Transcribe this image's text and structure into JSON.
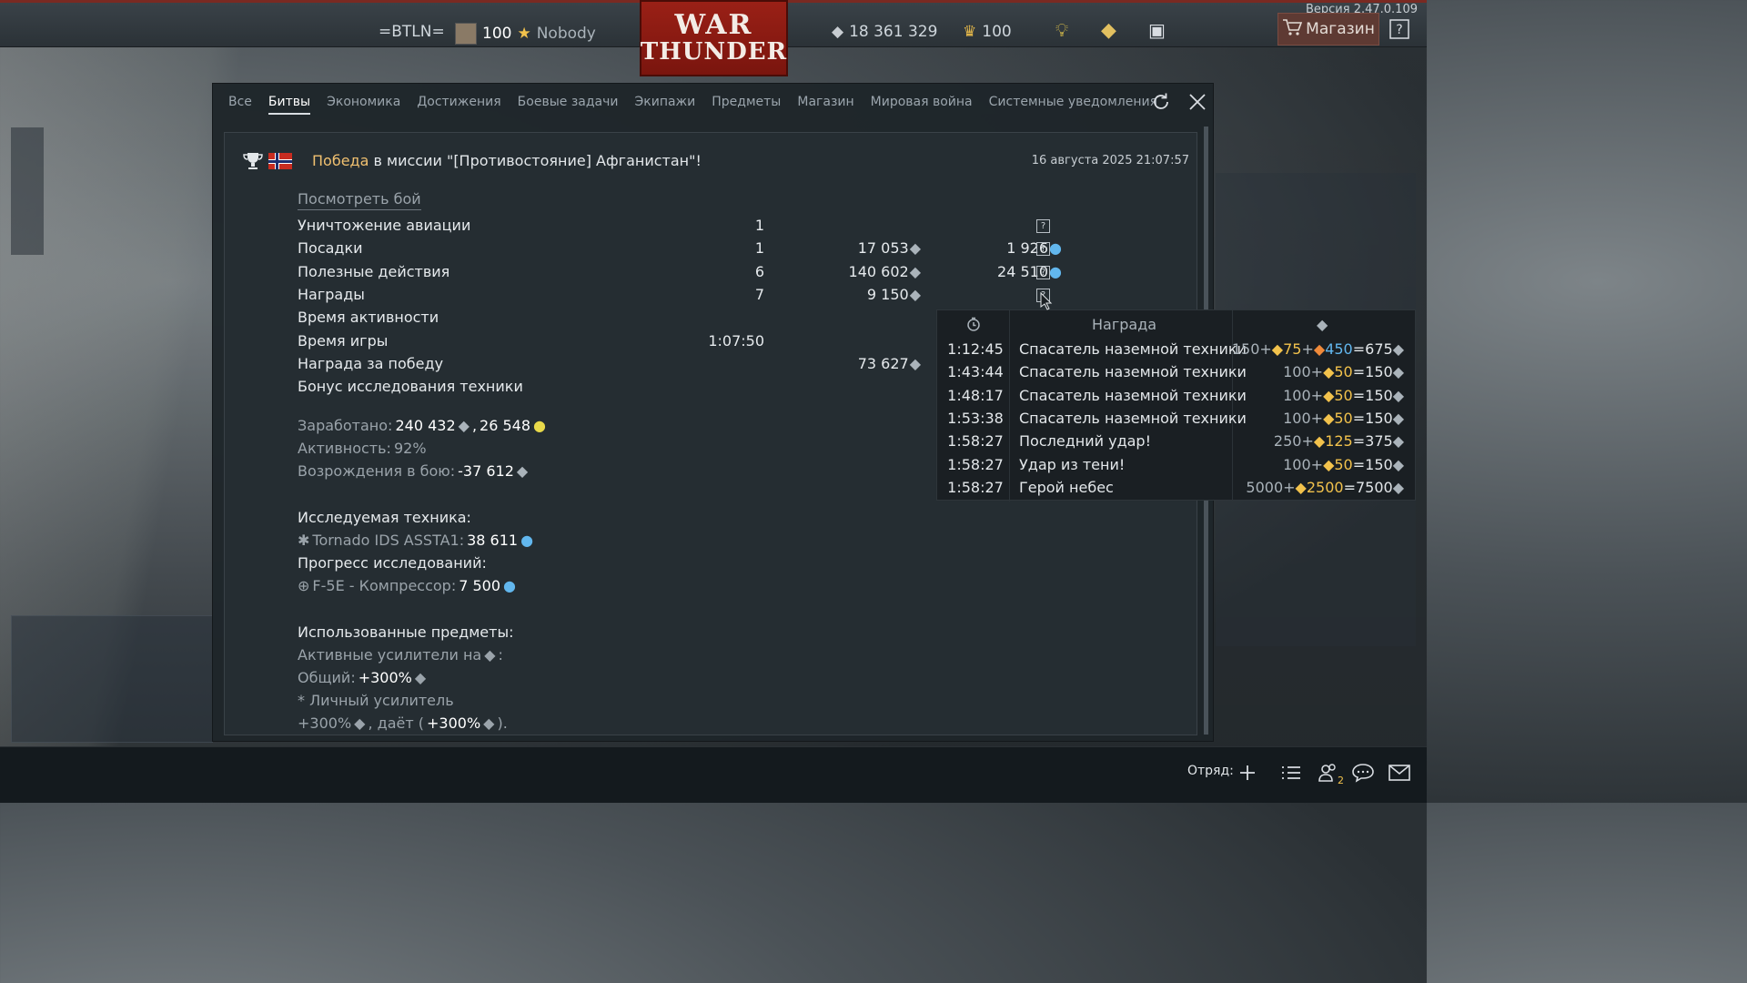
{
  "topbar": {
    "version": "Версия 2.47.0.109",
    "squad_tag": "=BTLN=",
    "level": "100",
    "nickname": "Nobody",
    "silver_lions": "18 361 329",
    "golden_eagles": "100",
    "logo_line1": "WAR",
    "logo_line2": "THUNDER",
    "shop_label": "Магазин",
    "help_label": "?"
  },
  "tabs": [
    {
      "label": "Все"
    },
    {
      "label": "Битвы"
    },
    {
      "label": "Экономика"
    },
    {
      "label": "Достижения"
    },
    {
      "label": "Боевые задачи"
    },
    {
      "label": "Экипажи"
    },
    {
      "label": "Предметы"
    },
    {
      "label": "Магазин"
    },
    {
      "label": "Мировая война"
    },
    {
      "label": "Системные уведомления"
    }
  ],
  "message": {
    "victory_word": "Победа",
    "title_rest": " в миссии \"[Противостояние] Афганистан\"!",
    "date": "16 августа 2025 21:07:57",
    "watch_battle": "Посмотреть бой",
    "rows": [
      {
        "label": "Уничтожение авиации",
        "count": "1",
        "silver": "",
        "rp": "",
        "help": true
      },
      {
        "label": "Посадки",
        "count": "1",
        "silver": "17 053",
        "rp": "1 926",
        "help": true
      },
      {
        "label": "Полезные действия",
        "count": "6",
        "silver": "140 602",
        "rp": "24 510",
        "help": true
      },
      {
        "label": "Награды",
        "count": "7",
        "silver": "9 150",
        "rp": "",
        "help": true
      },
      {
        "label": "Время активности",
        "count": "",
        "silver": "",
        "rp": "",
        "help": false
      },
      {
        "label": "Время игры",
        "count": "1:07:50",
        "silver": "",
        "rp": "",
        "help": false
      },
      {
        "label": "Награда за победу",
        "count": "",
        "silver": "73 627",
        "rp": "",
        "help": false
      },
      {
        "label": "Бонус исследования техники",
        "count": "",
        "silver": "",
        "rp": "",
        "help": false
      }
    ],
    "earned_label": "Заработано:",
    "earned_silver": "240 432",
    "earned_rp": "26 548",
    "activity_label": "Активность:",
    "activity_value": "92%",
    "respawn_label": "Возрождения в бою:",
    "respawn_value": "-37 612",
    "research_label": "Исследуемая техника:",
    "research_vehicle": "Tornado IDS ASSTA1:",
    "research_value": "38 611",
    "progress_label": "Прогресс исследований:",
    "progress_item": "F-5E - Компрессор:",
    "progress_value": "7 500",
    "used_items_label": "Использованные предметы:",
    "boosters_label": "Активные усилители на",
    "total_label": "Общий:",
    "total_value": "+300%",
    "personal_label": "* Личный усилитель",
    "personal_value": "+300%",
    "gives_label": ", даёт (",
    "gives_value": "+300%",
    "gives_end": ")."
  },
  "tooltip": {
    "header_award": "Награда",
    "rows": [
      {
        "time": "1:12:45",
        "name": "Спасатель наземной техники",
        "base": "150+",
        "bonus_gold": "75",
        "bonus_blue": "450",
        "total": "=675"
      },
      {
        "time": "1:43:44",
        "name": "Спасатель наземной техники",
        "base": "100+",
        "bonus_gold": "50",
        "bonus_blue": "",
        "total": "=150"
      },
      {
        "time": "1:48:17",
        "name": "Спасатель наземной техники",
        "base": "100+",
        "bonus_gold": "50",
        "bonus_blue": "",
        "total": "=150"
      },
      {
        "time": "1:53:38",
        "name": "Спасатель наземной техники",
        "base": "100+",
        "bonus_gold": "50",
        "bonus_blue": "",
        "total": "=150"
      },
      {
        "time": "1:58:27",
        "name": "Последний удар!",
        "base": "250+",
        "bonus_gold": "125",
        "bonus_blue": "",
        "total": "=375"
      },
      {
        "time": "1:58:27",
        "name": "Удар из тени!",
        "base": "100+",
        "bonus_gold": "50",
        "bonus_blue": "",
        "total": "=150"
      },
      {
        "time": "1:58:27",
        "name": "Герой небес",
        "base": "5000+",
        "bonus_gold": "2500",
        "bonus_blue": "",
        "total": "=7500"
      }
    ]
  },
  "bottombar": {
    "squad_label": "Отряд:",
    "friends_count": "2"
  },
  "colors": {
    "accent_victory": "#f0c070",
    "gold_bonus": "#f2c24c",
    "blue_bonus": "#62b7ee",
    "logo_red": "#9a2016"
  },
  "icons": [
    "trophy-icon",
    "flag-icon",
    "silver-lion-icon",
    "research-point-icon",
    "golden-eagle-icon",
    "refresh-icon",
    "close-icon",
    "cart-icon",
    "help-icon",
    "plus-icon",
    "list-icon",
    "friends-icon",
    "chat-icon",
    "mail-icon",
    "clock-icon"
  ]
}
